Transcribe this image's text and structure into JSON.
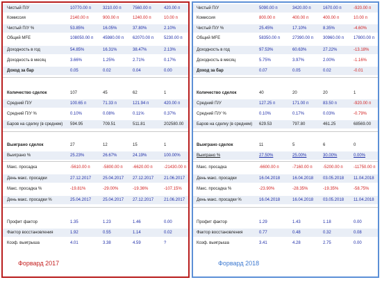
{
  "labels": [
    "Чистый П/У",
    "Комиссия",
    "Чистый П/У %",
    "Общий MFE",
    "Доходность в год",
    "Доходность в месяц",
    "Доход за бар",
    "",
    "Количество сделок",
    "Средний П/У",
    "Средний П/У %",
    "Баров на сделку (в среднем)",
    "",
    "Выиграно сделок",
    "Выиграно %",
    "Макс. просадка",
    "День макс. просадки",
    "Макс. просадка %",
    "День макс. просадки %",
    "",
    "Профит фактор",
    "Фактор восстановления",
    "Коэф. выигрыша"
  ],
  "panels": [
    {
      "footer": "Форвард 2017",
      "rows": [
        [
          "10770.00 п",
          "3210.00 п",
          "7560.00 п",
          "420.00 п"
        ],
        [
          "2140.00 п",
          "900.00 п",
          "1240.00 п",
          "10.00 п"
        ],
        [
          "53.85%",
          "16.05%",
          "37.80%",
          "2.10%"
        ],
        [
          "108050.00 п",
          "45980.00 п",
          "62070.00 п",
          "5230.00 п"
        ],
        [
          "54.85%",
          "16.31%",
          "38.47%",
          "2.13%"
        ],
        [
          "3.66%",
          "1.25%",
          "2.71%",
          "0.17%"
        ],
        [
          "0.05",
          "0.02",
          "0.04",
          "0.00"
        ],
        [
          "",
          "",
          "",
          ""
        ],
        [
          "107",
          "45",
          "62",
          "1"
        ],
        [
          "100.65 п",
          "71.33 п",
          "121.94 п",
          "420.00 п"
        ],
        [
          "0.10%",
          "0.08%",
          "0.11%",
          "0.37%"
        ],
        [
          "594.95",
          "709.51",
          "511.81",
          "202580.00"
        ],
        [
          "",
          "",
          "",
          ""
        ],
        [
          "27",
          "12",
          "15",
          "1"
        ],
        [
          "25.23%",
          "26.67%",
          "24.19%",
          "100.00%"
        ],
        [
          "-5610.00 п",
          "-5800.00 п",
          "-6620.00 п",
          "-21430.00 п"
        ],
        [
          "27.12.2017",
          "25.04.2017",
          "27.12.2017",
          "21.06.2017"
        ],
        [
          "-19.81%",
          "-29.00%",
          "-19.36%",
          "-107.15%"
        ],
        [
          "25.04.2017",
          "25.04.2017",
          "27.12.2017",
          "21.06.2017"
        ],
        [
          "",
          "",
          "",
          ""
        ],
        [
          "1.35",
          "1.23",
          "1.46",
          "0.00"
        ],
        [
          "1.92",
          "0.55",
          "1.14",
          "0.02"
        ],
        [
          "4.01",
          "3.38",
          "4.59",
          "?"
        ]
      ]
    },
    {
      "footer": "Форвард 2018",
      "rows": [
        [
          "5090.00 п",
          "3420.00 п",
          "1670.00 п",
          "-920.00 п"
        ],
        [
          "800.00 п",
          "400.00 п",
          "400.00 п",
          "10.00 п"
        ],
        [
          "25.45%",
          "17.10%",
          "8.35%",
          "-4.60%"
        ],
        [
          "58350.00 п",
          "27390.00 п",
          "30960.00 п",
          "17800.00 п"
        ],
        [
          "97.53%",
          "60.63%",
          "27.22%",
          "-13.18%"
        ],
        [
          "5.75%",
          "3.97%",
          "2.00%",
          "-1.16%"
        ],
        [
          "0.07",
          "0.05",
          "0.02",
          "-0.01"
        ],
        [
          "",
          "",
          "",
          ""
        ],
        [
          "40",
          "20",
          "20",
          "1"
        ],
        [
          "127.25 п",
          "171.00 п",
          "83.50 п",
          "-920.00 п"
        ],
        [
          "0.10%",
          "0.17%",
          "0.03%",
          "-0.79%"
        ],
        [
          "629.53",
          "797.80",
          "461.25",
          "68569.00"
        ],
        [
          "",
          "",
          "",
          ""
        ],
        [
          "11",
          "5",
          "6",
          "0"
        ],
        [
          "27.50%",
          "25.00%",
          "30.00%",
          "0.00%"
        ],
        [
          "-6600.00 п",
          "-7160.00 п",
          "-5200.00 п",
          "-11750.00 п"
        ],
        [
          "16.04.2018",
          "16.04.2018",
          "03.05.2018",
          "11.04.2018"
        ],
        [
          "-23.90%",
          "-28.35%",
          "-19.35%",
          "-58.75%"
        ],
        [
          "16.04.2018",
          "16.04.2018",
          "03.05.2018",
          "11.04.2018"
        ],
        [
          "",
          "",
          "",
          ""
        ],
        [
          "1.29",
          "1.43",
          "1.18",
          "0.00"
        ],
        [
          "0.77",
          "0.48",
          "0.32",
          "0.08"
        ],
        [
          "3.41",
          "4.28",
          "2.75",
          "0.00"
        ]
      ]
    }
  ],
  "colors": {
    "value_blue": "#1f2ea8",
    "value_red": "#d21e1e",
    "border_2017": "#b81c1c",
    "border_2018": "#5b8fd6"
  }
}
